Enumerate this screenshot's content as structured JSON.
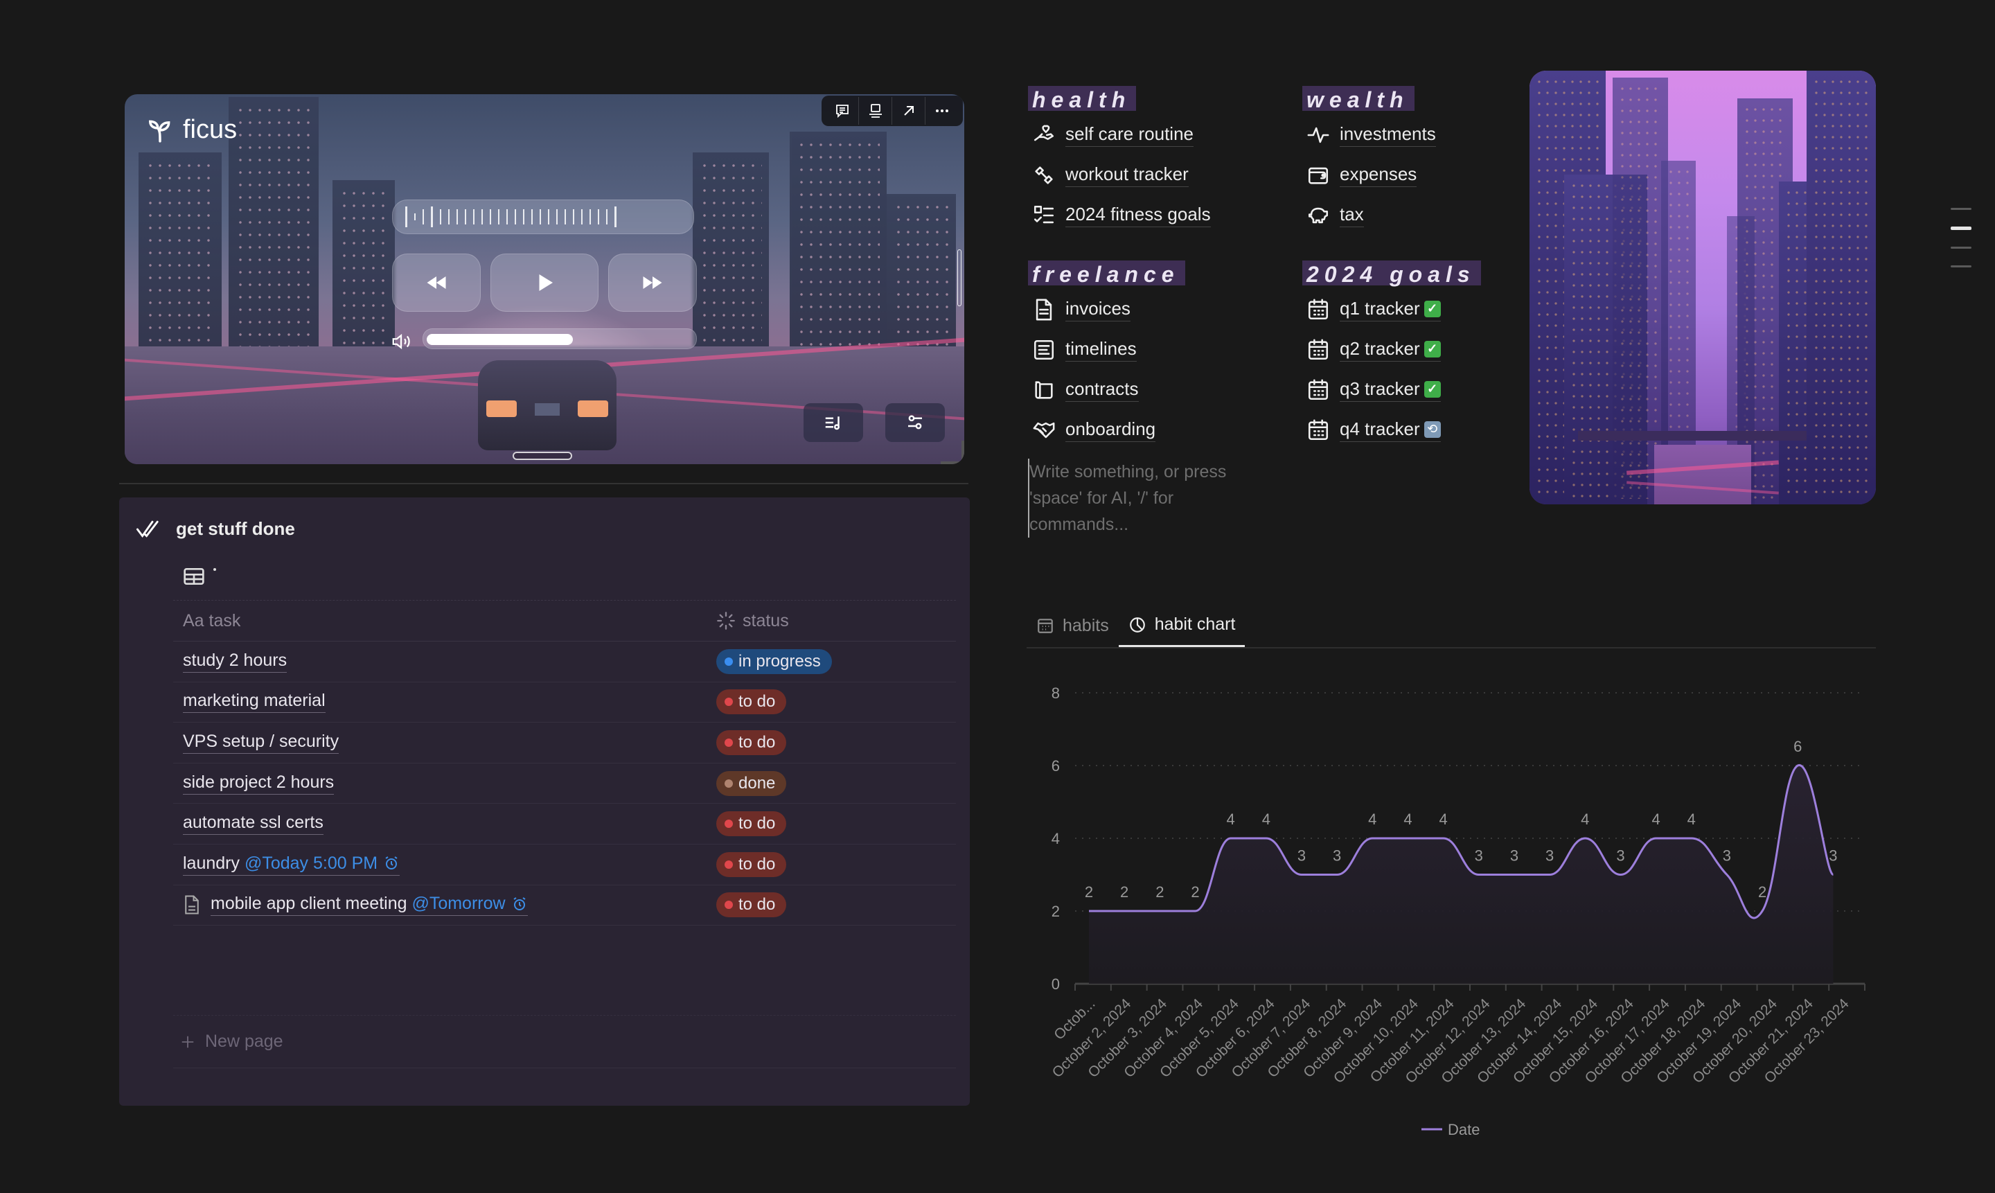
{
  "player": {
    "brand": "ficus",
    "toolbar": [
      "comment-icon",
      "caption-icon",
      "open-arrow-icon",
      "more-icon"
    ],
    "volume_level": 0.55
  },
  "tasks": {
    "title": "get stuff done",
    "view_name": "·",
    "columns": {
      "task": "Aa task",
      "status": "status"
    },
    "rows": [
      {
        "task": "study 2 hours",
        "mention": "",
        "status": "in progress",
        "status_key": "progress",
        "has_doc_icon": false
      },
      {
        "task": "marketing material",
        "mention": "",
        "status": "to do",
        "status_key": "todo",
        "has_doc_icon": false
      },
      {
        "task": "VPS setup / security",
        "mention": "",
        "status": "to do",
        "status_key": "todo",
        "has_doc_icon": false
      },
      {
        "task": "side project 2 hours",
        "mention": "",
        "status": "done",
        "status_key": "done",
        "has_doc_icon": false
      },
      {
        "task": "automate ssl certs",
        "mention": "",
        "status": "to do",
        "status_key": "todo",
        "has_doc_icon": false
      },
      {
        "task": "laundry",
        "mention": "@Today 5:00 PM",
        "status": "to do",
        "status_key": "todo",
        "has_doc_icon": false
      },
      {
        "task": "mobile app client meeting",
        "mention": "@Tomorrow",
        "status": "to do",
        "status_key": "todo",
        "has_doc_icon": true
      }
    ],
    "new_page_label": "New page",
    "status_colors": {
      "progress": {
        "bg": "#1f4a7c",
        "dot": "#3a8ef0"
      },
      "todo": {
        "bg": "#6e2d28",
        "dot": "#e0474c"
      },
      "done": {
        "bg": "#5e3828",
        "dot": "#b08470"
      }
    }
  },
  "sections": {
    "health": {
      "heading": "health",
      "links": [
        {
          "label": "self care routine",
          "icon": "hand-heart-icon"
        },
        {
          "label": "workout tracker",
          "icon": "dumbbell-icon"
        },
        {
          "label": "2024 fitness goals",
          "icon": "checklist-icon"
        }
      ]
    },
    "wealth": {
      "heading": "wealth",
      "links": [
        {
          "label": "investments",
          "icon": "pulse-icon"
        },
        {
          "label": "expenses",
          "icon": "wallet-icon"
        },
        {
          "label": "tax",
          "icon": "piggy-bank-icon"
        }
      ]
    },
    "freelance": {
      "heading": "freelance",
      "links": [
        {
          "label": "invoices",
          "icon": "document-icon"
        },
        {
          "label": "timelines",
          "icon": "text-box-icon"
        },
        {
          "label": "contracts",
          "icon": "scroll-icon"
        },
        {
          "label": "onboarding",
          "icon": "handshake-icon"
        }
      ]
    },
    "goals": {
      "heading": "2024 goals",
      "links": [
        {
          "label": "q1 tracker",
          "icon": "calendar-icon",
          "badge": "check"
        },
        {
          "label": "q2 tracker",
          "icon": "calendar-icon",
          "badge": "check"
        },
        {
          "label": "q3 tracker",
          "icon": "calendar-icon",
          "badge": "check"
        },
        {
          "label": "q4 tracker",
          "icon": "calendar-icon",
          "badge": "repeat"
        }
      ]
    }
  },
  "editor": {
    "placeholder": "Write something, or press 'space' for AI, '/' for commands..."
  },
  "chart_tabs": [
    {
      "label": "habits",
      "icon": "calendar-icon",
      "active": false
    },
    {
      "label": "habit chart",
      "icon": "pie-chart-icon",
      "active": true
    }
  ],
  "chart_data": {
    "type": "area",
    "title": "",
    "xlabel": "",
    "ylabel": "",
    "categories": [
      "Octob...",
      "October 2, 2024",
      "October 3, 2024",
      "October 4, 2024",
      "October 5, 2024",
      "October 6, 2024",
      "October 7, 2024",
      "October 8, 2024",
      "October 9, 2024",
      "October 10, 2024",
      "October 11, 2024",
      "October 12, 2024",
      "October 13, 2024",
      "October 14, 2024",
      "October 15, 2024",
      "October 16, 2024",
      "October 17, 2024",
      "October 18, 2024",
      "October 19, 2024",
      "October 20, 2024",
      "October 21, 2024",
      "October 23, 2024"
    ],
    "series": [
      {
        "name": "Date",
        "values": [
          2,
          2,
          2,
          2,
          4,
          4,
          3,
          3,
          4,
          4,
          4,
          3,
          3,
          3,
          4,
          3,
          4,
          4,
          3,
          2,
          6,
          3
        ],
        "color": "#9d7fdc"
      }
    ],
    "ylim": [
      0,
      8
    ],
    "yticks": [
      0,
      2,
      4,
      6,
      8
    ],
    "grid": true,
    "data_labels": true,
    "legend": "bottom-center",
    "curve": "smooth"
  }
}
